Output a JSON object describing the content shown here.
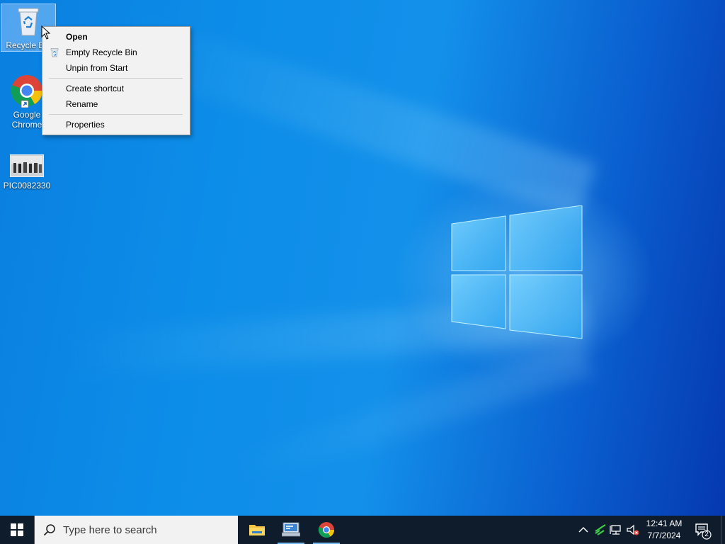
{
  "desktop": {
    "icons": [
      {
        "label": "Recycle Bin",
        "icon": "recycle-bin-icon",
        "selected": true
      },
      {
        "label": "Google Chrome",
        "icon": "chrome-icon"
      },
      {
        "label": "PIC0082330",
        "icon": "image-thumbnail-icon"
      }
    ]
  },
  "context_menu": {
    "items": [
      {
        "label": "Open",
        "bold": true
      },
      {
        "label": "Empty Recycle Bin",
        "icon": "recycle-bin-small-icon"
      },
      {
        "label": "Unpin from Start"
      },
      {
        "label": "Create shortcut"
      },
      {
        "label": "Rename"
      },
      {
        "label": "Properties"
      }
    ]
  },
  "taskbar": {
    "search_placeholder": "Type here to search",
    "apps": [
      {
        "name": "File Explorer",
        "icon": "file-explorer-icon"
      },
      {
        "name": "Control Panel",
        "icon": "control-panel-icon",
        "active": true
      },
      {
        "name": "Google Chrome",
        "icon": "chrome-icon",
        "active": true
      }
    ],
    "tray": {
      "icons": [
        "chevron-up-icon",
        "network-activity-icon",
        "network-icon",
        "volume-muted-icon"
      ],
      "time": "12:41 AM",
      "date": "7/7/2024",
      "notification_count": "2"
    }
  },
  "colors": {
    "taskbar_bg": "#0f1c2b",
    "desktop_blue": "#0a7fe0",
    "menu_bg": "#f2f2f2"
  }
}
